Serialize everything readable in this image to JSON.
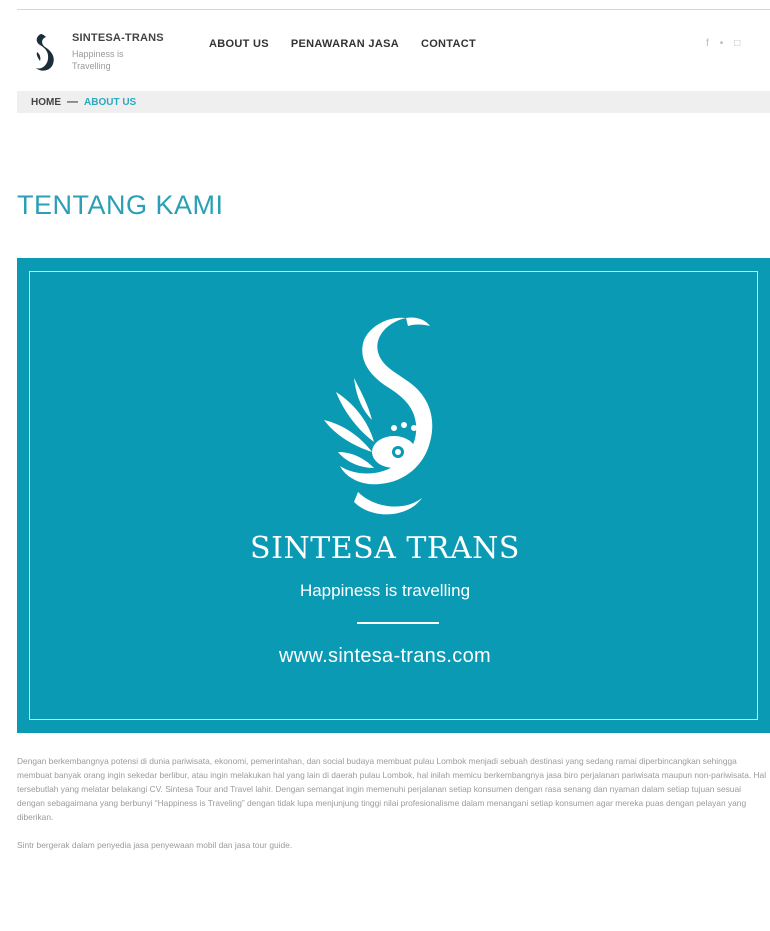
{
  "header": {
    "brand_name": "SINTESA-TRANS",
    "brand_tagline": "Happiness is Travelling",
    "nav": [
      {
        "label": "ABOUT US"
      },
      {
        "label": "PENAWARAN JASA"
      },
      {
        "label": "CONTACT"
      }
    ],
    "social": [
      {
        "icon": "facebook-icon",
        "glyph": "f"
      },
      {
        "icon": "twitter-icon",
        "glyph": "•"
      },
      {
        "icon": "instagram-icon",
        "glyph": "□"
      }
    ]
  },
  "breadcrumb": {
    "home": "HOME",
    "arrow": "—",
    "current": "ABOUT US"
  },
  "page": {
    "title": "TENTANG KAMI"
  },
  "banner": {
    "title": "SINTESA TRANS",
    "subtitle": "Happiness is travelling",
    "url": "www.sintesa-trans.com",
    "background_color": "#0a9ab4"
  },
  "content": {
    "paragraph1": "Dengan berkembangnya potensi di dunia pariwisata, ekonomi, pemerintahan, dan social budaya membuat pulau Lombok menjadi sebuah destinasi yang sedang ramai diperbincangkan sehingga membuat banyak orang ingin sekedar berlibur, atau ingin melakukan hal yang lain di daerah pulau Lombok, hal inilah memicu berkembangnya jasa biro perjalanan pariwisata maupun non-pariwisata. Hal tersebutlah yang melatar belakangi CV. Sintesa Tour and Travel lahir. Dengan semangat ingin memenuhi perjalanan setiap konsumen dengan rasa senang dan nyaman dalam setiap tujuan sesuai dengan sebagaimana yang berbunyi “Happiness is Traveling” dengan tidak lupa menjunjung tinggi nilai profesionalisme dalam menangani setiap konsumen agar mereka puas dengan pelayan yang diberikan.",
    "paragraph2": "Sintr bergerak dalam penyedia jasa penyewaan mobil dan jasa tour guide."
  },
  "colors": {
    "accent": "#2a9fb5",
    "banner": "#0a9ab4"
  }
}
